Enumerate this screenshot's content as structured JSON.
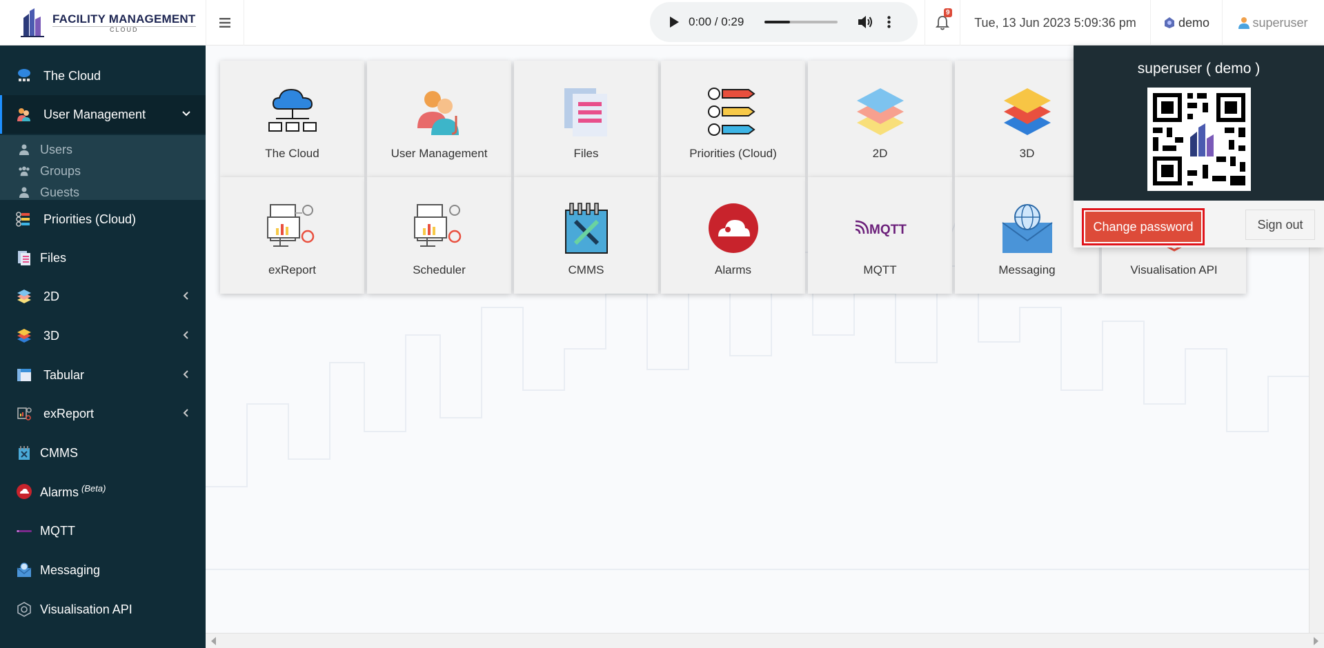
{
  "header": {
    "brand_name": "FACILITY MANAGEMENT",
    "brand_sub": "CLOUD",
    "audio": {
      "time": "0:00 / 0:29",
      "progress": 0.35
    },
    "notifications_count": "9",
    "datetime": "Tue, 13 Jun 2023 5:09:36 pm",
    "tenant": "demo",
    "username": "superuser"
  },
  "sidebar": {
    "items": [
      {
        "label": "The Cloud",
        "icon": "cloud-network-icon"
      },
      {
        "label": "User Management",
        "icon": "users-icon",
        "active": true,
        "expanded": true
      },
      {
        "label": "Priorities (Cloud)",
        "icon": "priorities-icon"
      },
      {
        "label": "Files",
        "icon": "files-icon"
      },
      {
        "label": "2D",
        "icon": "layers-2d-icon",
        "has_children": true
      },
      {
        "label": "3D",
        "icon": "layers-3d-icon",
        "has_children": true
      },
      {
        "label": "Tabular",
        "icon": "table-icon",
        "has_children": true
      },
      {
        "label": "exReport",
        "icon": "report-icon",
        "has_children": true
      },
      {
        "label": "CMMS",
        "icon": "cmms-icon"
      },
      {
        "label": "Alarms",
        "badge": "(Beta)",
        "icon": "alarm-icon"
      },
      {
        "label": "MQTT",
        "icon": "mqtt-icon"
      },
      {
        "label": "Messaging",
        "icon": "messaging-icon"
      },
      {
        "label": "Visualisation API",
        "icon": "api-icon"
      }
    ],
    "submenu": [
      {
        "label": "Users",
        "icon": "user-icon"
      },
      {
        "label": "Groups",
        "icon": "group-icon"
      },
      {
        "label": "Guests",
        "icon": "guest-icon"
      }
    ]
  },
  "tiles": [
    {
      "label": "The Cloud",
      "icon": "cloud-network-icon"
    },
    {
      "label": "User Management",
      "icon": "users-icon"
    },
    {
      "label": "Files",
      "icon": "files-icon"
    },
    {
      "label": "Priorities (Cloud)",
      "icon": "priorities-icon"
    },
    {
      "label": "2D",
      "icon": "layers-2d-icon"
    },
    {
      "label": "3D",
      "icon": "layers-3d-icon"
    },
    {
      "label": "exReport",
      "icon": "report-icon"
    },
    {
      "label": "Scheduler",
      "icon": "scheduler-icon"
    },
    {
      "label": "CMMS",
      "icon": "cmms-icon"
    },
    {
      "label": "Alarms",
      "icon": "alarm-icon"
    },
    {
      "label": "MQTT",
      "icon": "mqtt-icon",
      "icon_text": "MQTT"
    },
    {
      "label": "Messaging",
      "icon": "messaging-icon"
    },
    {
      "label": "Visualisation API",
      "icon": "api-icon"
    }
  ],
  "user_panel": {
    "title": "superuser ( demo )",
    "change_password": "Change password",
    "sign_out": "Sign out"
  },
  "colors": {
    "sidebar_bg": "#102c37",
    "primary_red": "#dd4b39",
    "highlight_border": "#e0141b",
    "panel_head": "#1e2d34"
  }
}
